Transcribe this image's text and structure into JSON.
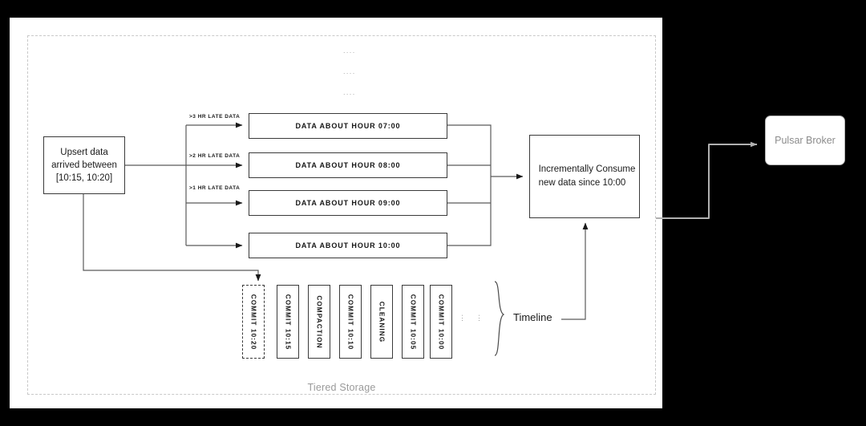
{
  "canvas": {
    "background": "#ffffff",
    "page_background": "#000000"
  },
  "container": {
    "label": "Tiered Storage",
    "border_color": "#c9c9c9",
    "label_color": "#9a9a9a"
  },
  "source": {
    "label": "Upsert data\narrived between\n[10:15, 10:20]"
  },
  "late_labels": [
    {
      "text": ">3 HR LATE DATA"
    },
    {
      "text": ">2 HR LATE DATA"
    },
    {
      "text": ">1 HR LATE DATA"
    }
  ],
  "data_boxes": [
    {
      "label": "DATA ABOUT HOUR 07:00"
    },
    {
      "label": "DATA ABOUT HOUR 08:00"
    },
    {
      "label": "DATA ABOUT HOUR 09:00"
    },
    {
      "label": "DATA ABOUT HOUR 10:00"
    }
  ],
  "top_dots": [
    {
      "text": "...."
    },
    {
      "text": "...."
    },
    {
      "text": "...."
    }
  ],
  "consumer": {
    "label": "Incrementally Consume\nnew data since 10:00"
  },
  "timeline": {
    "label": "Timeline",
    "ellipsis_1": "...",
    "ellipsis_2": "...",
    "commits": [
      {
        "label": "COMMIT 10:20",
        "style": "dashed"
      },
      {
        "label": "COMMIT 10:15",
        "style": "solid"
      },
      {
        "label": "COMPACTION",
        "style": "solid"
      },
      {
        "label": "COMMIT 10:10",
        "style": "solid"
      },
      {
        "label": "CLEANING",
        "style": "solid"
      },
      {
        "label": "COMMIT 10:05",
        "style": "solid"
      },
      {
        "label": "COMMIT 10:00",
        "style": "solid"
      }
    ]
  },
  "broker": {
    "label": "Pulsar Broker",
    "border_color": "#b4b4b4",
    "text_color": "#8c8c8c"
  },
  "colors": {
    "stroke_dark": "#3a3a3a",
    "stroke_grey": "#b4b4b4",
    "text_dark": "#161616"
  }
}
